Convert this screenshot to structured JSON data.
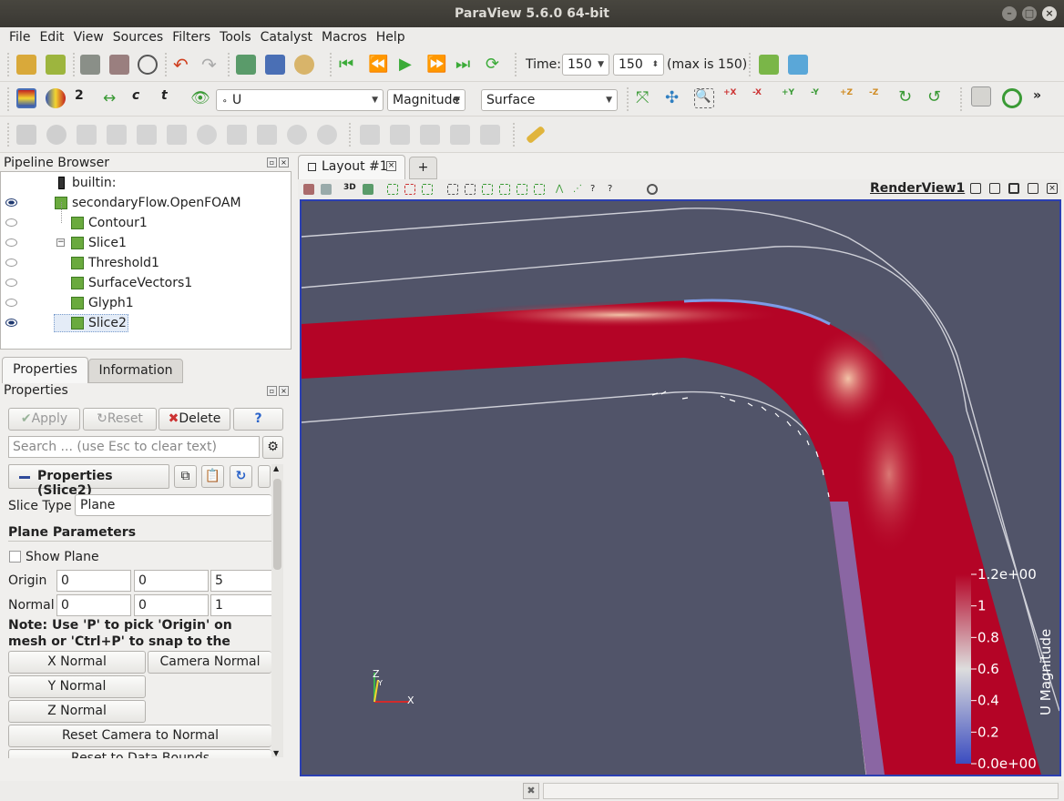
{
  "window": {
    "title": "ParaView 5.6.0 64-bit"
  },
  "menu": [
    "File",
    "Edit",
    "View",
    "Sources",
    "Filters",
    "Tools",
    "Catalyst",
    "Macros",
    "Help"
  ],
  "time_toolbar": {
    "time_label": "Time:",
    "time_value": "150",
    "timestep_value": "150",
    "max_label": "(max is 150)"
  },
  "display_toolbar": {
    "array": "U",
    "component": "Magnitude",
    "representation": "Surface"
  },
  "pipeline": {
    "title": "Pipeline Browser",
    "items": [
      {
        "label": "builtin:",
        "visible": null
      },
      {
        "label": "secondaryFlow.OpenFOAM",
        "visible": true
      },
      {
        "label": "Contour1",
        "visible": false
      },
      {
        "label": "Slice1",
        "visible": false
      },
      {
        "label": "Threshold1",
        "visible": false
      },
      {
        "label": "SurfaceVectors1",
        "visible": false
      },
      {
        "label": "Glyph1",
        "visible": false
      },
      {
        "label": "Slice2",
        "visible": true
      }
    ]
  },
  "tabs": {
    "properties": "Properties",
    "information": "Information"
  },
  "properties": {
    "title": "Properties",
    "apply": "Apply",
    "reset": "Reset",
    "delete": "Delete",
    "help": "?",
    "search_placeholder": "Search ... (use Esc to clear text)",
    "section": "Properties (Slice2)",
    "slice_type_label": "Slice Type",
    "slice_type": "Plane",
    "plane_params": "Plane Parameters",
    "show_plane": "Show Plane",
    "origin_label": "Origin",
    "origin": [
      "0",
      "0",
      "5"
    ],
    "normal_label": "Normal",
    "normal": [
      "0",
      "0",
      "1"
    ],
    "note": "Note: Use 'P' to pick 'Origin' on mesh or 'Ctrl+P' to snap to the closest mesh poin",
    "x_normal": "X Normal",
    "camera_normal": "Camera Normal",
    "y_normal": "Y Normal",
    "z_normal": "Z Normal",
    "reset_camera": "Reset Camera to Normal",
    "reset_bounds": "Reset to Data Bounds"
  },
  "layout": {
    "tab": "Layout #1",
    "add": "+",
    "view_label": "RenderView1",
    "view_3d": "3D"
  },
  "colorbar": {
    "title": "U Magnitude",
    "ticks": [
      "1.2e+00",
      "1",
      "0.8",
      "0.6",
      "0.4",
      "0.2",
      "0.0e+00"
    ],
    "min": 0,
    "max": 1.2
  },
  "axes": {
    "x": "X",
    "y": "Y",
    "z": "Z"
  },
  "colors": {
    "background": "#515469",
    "highlight": "#2b3fb2",
    "flow_high": "#b4041a",
    "flow_low": "#3b4cc0"
  }
}
